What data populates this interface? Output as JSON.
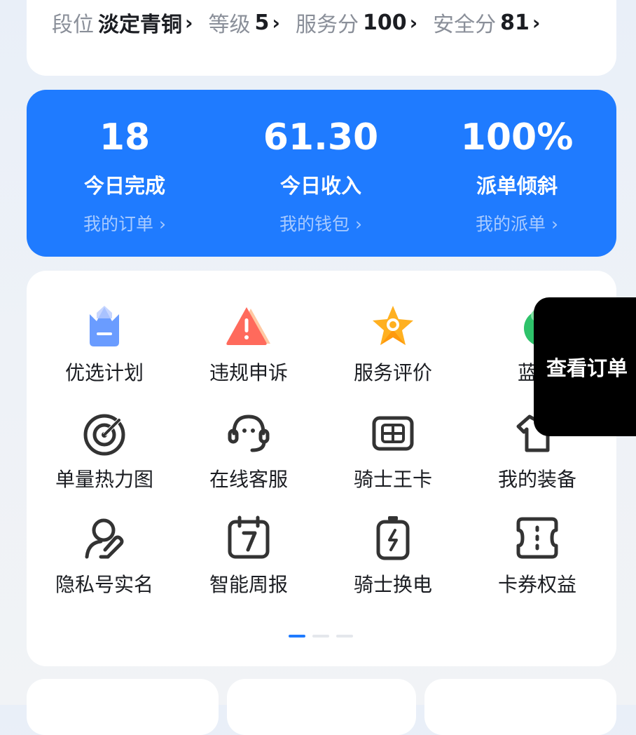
{
  "rank_bar": {
    "items": [
      {
        "label": "段位",
        "value": "淡定青铜"
      },
      {
        "label": "等级",
        "value": "5"
      },
      {
        "label": "服务分",
        "value": "100"
      },
      {
        "label": "安全分",
        "value": "81"
      }
    ]
  },
  "stats": [
    {
      "value": "18",
      "title": "今日完成",
      "link": "我的订单 ›"
    },
    {
      "value": "61.30",
      "title": "今日收入",
      "link": "我的钱包 ›"
    },
    {
      "value": "100%",
      "title": "派单倾斜",
      "link": "我的派单 ›"
    }
  ],
  "menu": [
    {
      "label": "优选计划",
      "icon": "crown-basket-icon"
    },
    {
      "label": "违规申诉",
      "icon": "warning-icon"
    },
    {
      "label": "服务评价",
      "icon": "star-icon"
    },
    {
      "label": "蓝色",
      "icon": "green-badge-icon"
    },
    {
      "label": "单量热力图",
      "icon": "target-icon"
    },
    {
      "label": "在线客服",
      "icon": "headset-icon"
    },
    {
      "label": "骑士王卡",
      "icon": "sim-card-icon"
    },
    {
      "label": "我的装备",
      "icon": "shirt-icon"
    },
    {
      "label": "隐私号实名",
      "icon": "user-edit-icon"
    },
    {
      "label": "智能周报",
      "icon": "calendar-icon"
    },
    {
      "label": "骑士换电",
      "icon": "battery-icon"
    },
    {
      "label": "卡券权益",
      "icon": "coupon-icon"
    }
  ],
  "float_button": {
    "label": "查看订单"
  },
  "pager": {
    "pages": 3,
    "active": 0
  },
  "colors": {
    "accent": "#1f7bff",
    "text": "#1b1d22",
    "muted": "#8a8f99"
  }
}
